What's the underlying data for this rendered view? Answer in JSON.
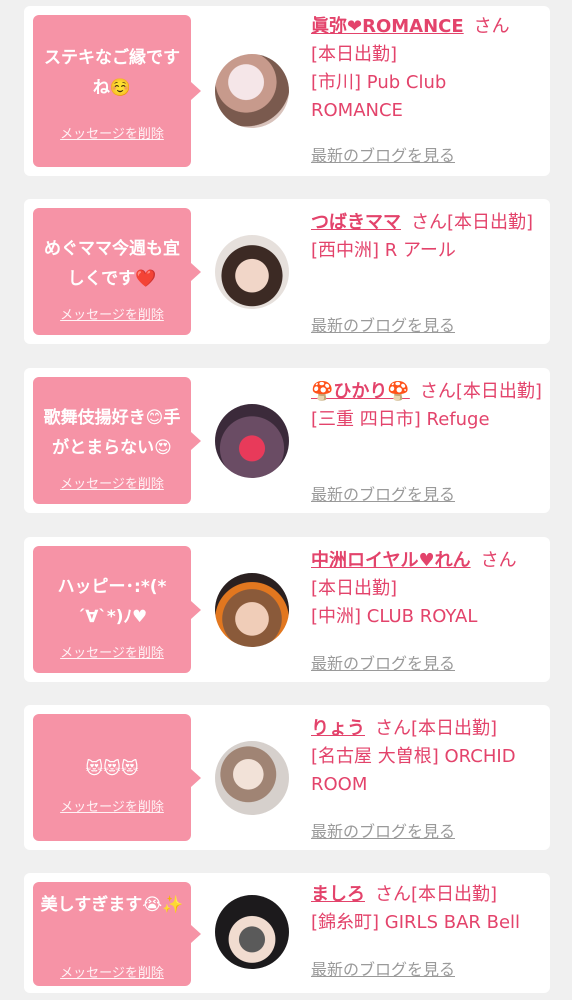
{
  "common": {
    "delete_label": "メッセージを削除",
    "blog_label": "最新のブログを見る",
    "honorific": "さん",
    "attendance": "[本日出勤]"
  },
  "cards": [
    {
      "message": "ステキなご縁ですね☺️",
      "name": "眞弥❤ROMANCE",
      "area": "[市川]",
      "shop": "Pub Club ROMANCE"
    },
    {
      "message": "めぐママ今週も宜しくです❤️",
      "name": "つばきママ",
      "area": "[西中洲]",
      "shop": "R アール"
    },
    {
      "message": "歌舞伎揚好き😊手がとまらない😍",
      "name": "🍄ひかり🍄",
      "area": "[三重 四日市]",
      "shop": "Refuge"
    },
    {
      "message": "ハッピー･:*(*´∀`*)ﾉ♥",
      "name": "中洲ロイヤル♥れん",
      "area": "[中洲]",
      "shop": "CLUB ROYAL"
    },
    {
      "message": "😻😻😻",
      "name": "りょう",
      "area": "[名古屋 大曽根]",
      "shop": "ORCHID ROOM"
    },
    {
      "message": "美しすぎます😭✨",
      "name": "ましろ",
      "area": "[錦糸町]",
      "shop": "GIRLS BAR Bell"
    }
  ]
}
